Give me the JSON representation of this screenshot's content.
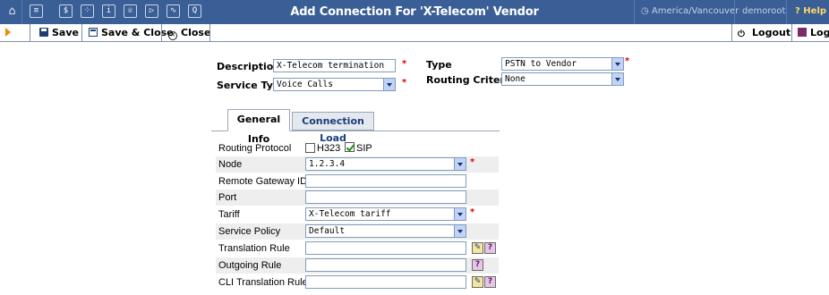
{
  "header": {
    "title": "Add Connection For 'X-Telecom' Vendor",
    "timezone": "America/Vancouver",
    "user": "demoroot",
    "help": "Help",
    "nav_icons": [
      "home-icon",
      "list-icon",
      "dollar-icon",
      "grid-icon",
      "person-icon",
      "phone-icon",
      "forward-icon",
      "chart-icon",
      "search-icon"
    ],
    "colors": {
      "bar": "#3a5e96",
      "accent": "#f08a00",
      "required": "#e00000"
    }
  },
  "toolbar": {
    "save": "Save",
    "save_close": "Save & Close",
    "close": "Close",
    "logout": "Logout",
    "log": "Log"
  },
  "form": {
    "description_label": "Description",
    "description_value": "X-Telecom termination",
    "service_type_label": "Service Type",
    "service_type_value": "Voice Calls",
    "type_label": "Type",
    "type_value": "PSTN to Vendor",
    "routing_criteria_label": "Routing Criteria",
    "routing_criteria_value": "None",
    "required_mark": "*"
  },
  "tabs": {
    "general": "General Info",
    "load": "Connection Load"
  },
  "general": {
    "routing_protocol_label": "Routing Protocol",
    "h323_label": "H323",
    "h323_checked": false,
    "sip_label": "SIP",
    "sip_checked": true,
    "node_label": "Node",
    "node_value": "1.2.3.4",
    "remote_gw_label": "Remote Gateway ID",
    "remote_gw_value": "",
    "port_label": "Port",
    "port_value": "",
    "tariff_label": "Tariff",
    "tariff_value": "X-Telecom tariff",
    "service_policy_label": "Service Policy",
    "service_policy_value": "Default",
    "translation_rule_label": "Translation Rule",
    "translation_rule_value": "",
    "outgoing_rule_label": "Outgoing Rule",
    "outgoing_rule_value": "",
    "cli_translation_rule_label": "CLI Translation Rule",
    "cli_translation_rule_value": ""
  }
}
